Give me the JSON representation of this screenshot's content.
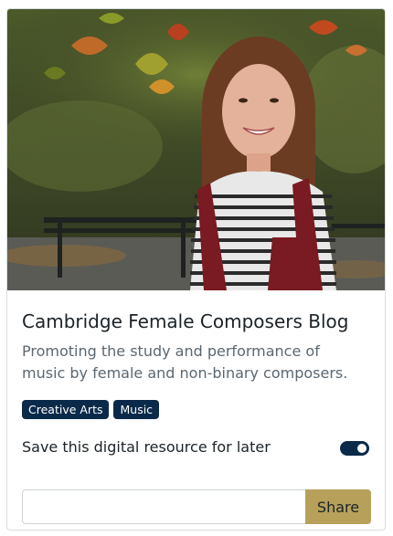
{
  "card": {
    "title": "Cambridge Female Composers Blog",
    "description": "Promoting the study and performance of music by female and non-binary composers.",
    "tags": [
      "Creative Arts",
      "Music"
    ],
    "save_label": "Save this digital resource for later",
    "save_toggle_on": true,
    "share": {
      "input_value": "",
      "input_placeholder": "",
      "button_label": "Share"
    }
  },
  "colors": {
    "tag_bg": "#0b2a4a",
    "toggle_bg": "#0b2a4a",
    "share_button_bg": "#b7a15a"
  }
}
